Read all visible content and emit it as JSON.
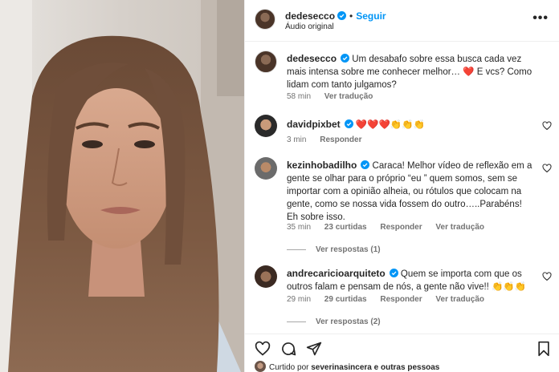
{
  "post": {
    "username": "dedesecco",
    "separator": "•",
    "follow_label": "Seguir",
    "audio": "Áudio original",
    "more_label": "•••"
  },
  "caption": {
    "username": "dedesecco",
    "text": "Um desabafo sobre essa busca cada vez mais intensa sobre me conhecer melhor… ❤️ E vcs? Como lidam com tanto julgamos?",
    "time": "58 min",
    "translate": "Ver tradução"
  },
  "comments": [
    {
      "username": "davidpixbet",
      "text": "❤️❤️❤️👏👏👏",
      "time": "3 min",
      "reply": "Responder"
    },
    {
      "username": "kezinhobadilho",
      "text": "Caraca! Melhor vídeo de reflexão em a gente se olhar para o próprio “eu ” quem somos, sem se importar com a opinião alheia, ou rótulos que colocam na gente, como se nossa vida fossem do outro…..Parabéns! Eh sobre isso.",
      "time": "35 min",
      "likes": "23 curtidas",
      "reply": "Responder",
      "translate": "Ver tradução",
      "view_replies": "Ver respostas (1)"
    },
    {
      "username": "andrecaricioarquiteto",
      "text": "Quem se importa com que os outros falam e pensam de nós, a gente não vive!! 👏👏👏",
      "time": "29 min",
      "likes": "29 curtidas",
      "reply": "Responder",
      "translate": "Ver tradução",
      "view_replies": "Ver respostas (2)"
    }
  ],
  "liked_by": {
    "prefix": "Curtido por",
    "user": "severinasincera",
    "suffix": "e outras pessoas"
  },
  "colors": {
    "accent": "#0095f6",
    "heart": "#ed4956",
    "muted": "#737373"
  },
  "icons": [
    "verified-icon",
    "heart-icon",
    "comment-icon",
    "share-icon",
    "bookmark-icon",
    "more-icon"
  ]
}
